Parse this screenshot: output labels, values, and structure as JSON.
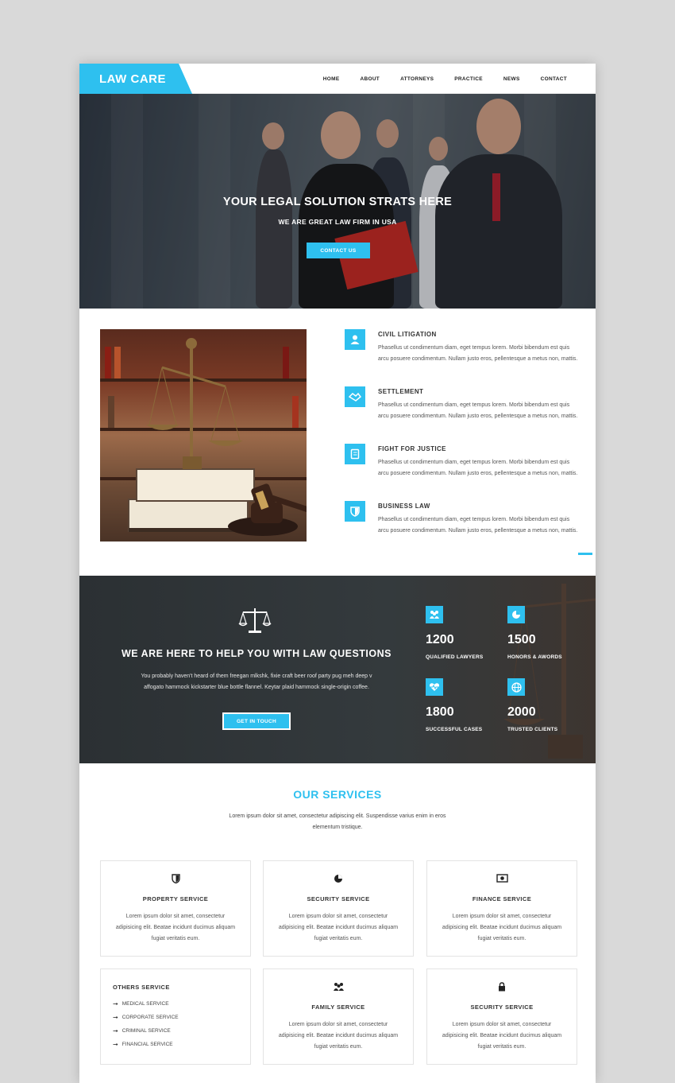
{
  "header": {
    "logo": "LAW CARE",
    "nav": [
      "HOME",
      "ABOUT",
      "ATTORNEYS",
      "PRACTICE",
      "NEWS",
      "CONTACT"
    ]
  },
  "hero": {
    "title": "YOUR LEGAL SOLUTION STRATS HERE",
    "subtitle": "WE ARE GREAT LAW FIRM IN USA",
    "button": "CONTACT US"
  },
  "features": [
    {
      "title": "CIVIL LITIGATION",
      "icon": "user-icon",
      "text": "Phasellus ut condimentum diam, eget tempus lorem. Morbi bibendum est quis arcu posuere condimentum. Nullam justo eros, pellentesque a metus non, mattis."
    },
    {
      "title": "SETTLEMENT",
      "icon": "handshake-icon",
      "text": "Phasellus ut condimentum diam, eget tempus lorem. Morbi bibendum est quis arcu posuere condimentum. Nullam justo eros, pellentesque a metus non, mattis."
    },
    {
      "title": "FIGHT FOR JUSTICE",
      "icon": "book-icon",
      "text": "Phasellus ut condimentum diam, eget tempus lorem. Morbi bibendum est quis arcu posuere condimentum. Nullam justo eros, pellentesque a metus non, mattis."
    },
    {
      "title": "BUSINESS LAW",
      "icon": "shield-icon",
      "text": "Phasellus ut condimentum diam, eget tempus lorem. Morbi bibendum est quis arcu posuere condimentum. Nullam justo eros, pellentesque a metus non, mattis."
    }
  ],
  "band": {
    "title": "WE ARE HERE TO HELP YOU WITH LAW QUESTIONS",
    "text": "You probably haven't heard of them freegan mlkshk, fixie craft beer roof party pug meh deep v affogato hammock kickstarter blue bottle flannel. Keytar plaid hammock single-origin coffee.",
    "button": "GET IN TOUCH",
    "stats": [
      {
        "num": "1200",
        "label": "QUALIFIED LAWYERS",
        "icon": "group-icon"
      },
      {
        "num": "1500",
        "label": "HONORS & AWORDS",
        "icon": "pie-chart-icon"
      },
      {
        "num": "1800",
        "label": "SUCCESSFUL CASES",
        "icon": "heartbeat-icon"
      },
      {
        "num": "2000",
        "label": "TRUSTED CLIENTS",
        "icon": "globe-icon"
      }
    ]
  },
  "services": {
    "title": "OUR SERVICES",
    "intro": "Lorem ipsum dolor sit amet, consectetur adipiscing elit. Suspendisse varius enim in eros elementum tristique.",
    "cards": [
      {
        "title": "PROPERTY SERVICE",
        "icon": "shield-icon",
        "text": "Lorem ipsum dolor sit amet, consectetur adipisicing elit. Beatae incidunt ducimus aliquam fugiat veritatis eum."
      },
      {
        "title": "SECURITY SERVICE",
        "icon": "pie-chart-icon",
        "text": "Lorem ipsum dolor sit amet, consectetur adipisicing elit. Beatae incidunt ducimus aliquam fugiat veritatis eum."
      },
      {
        "title": "FINANCE SERVICE",
        "icon": "money-icon",
        "text": "Lorem ipsum dolor sit amet, consectetur adipisicing elit. Beatae incidunt ducimus aliquam fugiat veritatis eum."
      },
      {
        "title": "FAMILY SERVICE",
        "icon": "group-icon",
        "text": "Lorem ipsum dolor sit amet, consectetur adipisicing elit. Beatae incidunt ducimus aliquam fugiat veritatis eum."
      },
      {
        "title": "SECURITY SERVICE",
        "icon": "lock-icon",
        "text": "Lorem ipsum dolor sit amet, consectetur adipisicing elit. Beatae incidunt ducimus aliquam fugiat veritatis eum."
      }
    ],
    "others": {
      "title": "OTHERS SERVICE",
      "items": [
        "MEDICAL SERVICE",
        "CORPORATE SERVICE",
        "CRIMINAL SERVICE",
        "FINANCIAL SERVICE"
      ]
    }
  },
  "colors": {
    "accent": "#2ec0ef",
    "dark_band": "#2b3033"
  }
}
